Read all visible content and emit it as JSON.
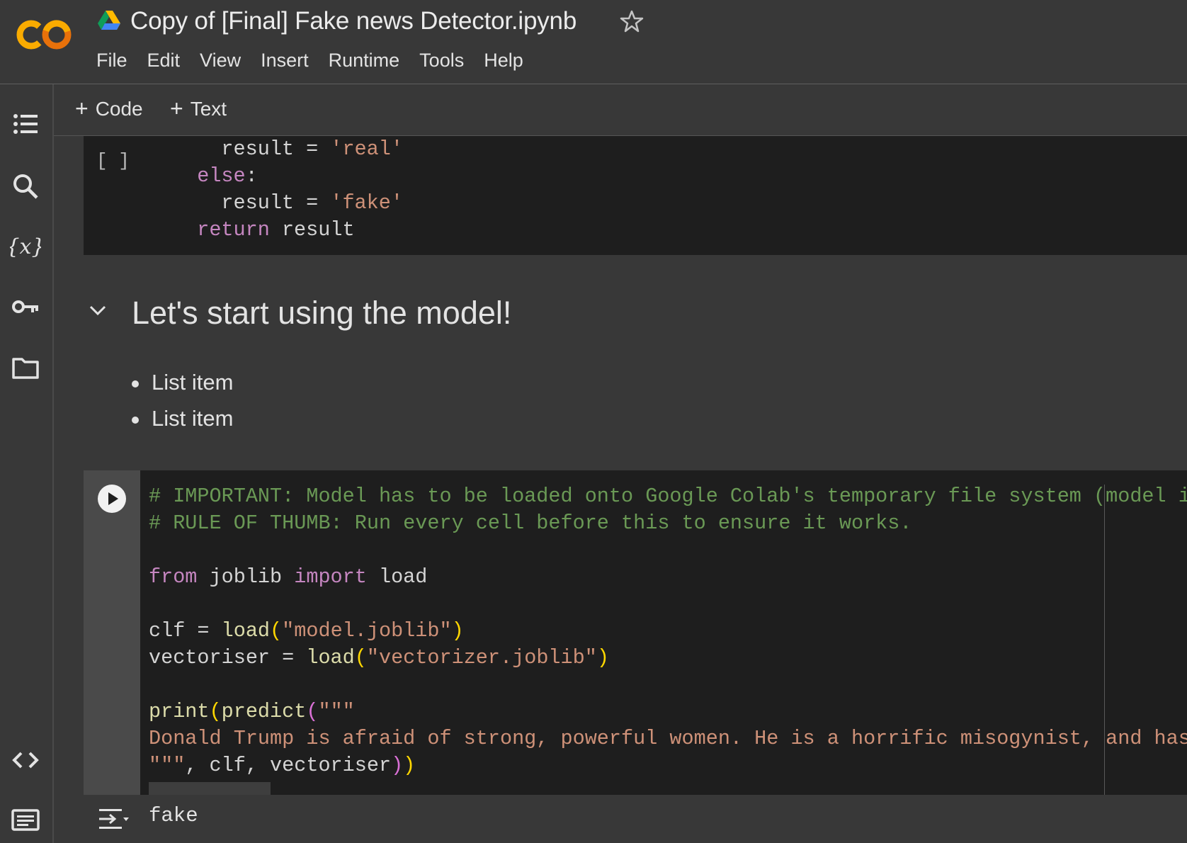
{
  "header": {
    "title": "Copy of [Final] Fake news Detector.ipynb",
    "logo_text": "CO",
    "menu": [
      "File",
      "Edit",
      "View",
      "Insert",
      "Runtime",
      "Tools",
      "Help"
    ]
  },
  "toolbar": {
    "code_label": "Code",
    "text_label": "Text"
  },
  "sidebar": {
    "icons": [
      "toc-icon",
      "search-icon",
      "variables-icon",
      "secrets-key-icon",
      "folder-icon",
      "code-snippets-icon",
      "terminal-icon"
    ]
  },
  "cells": {
    "cell1": {
      "exec_count": "[ ]",
      "lines": [
        [
          [
            "    result = ",
            ""
          ],
          [
            "'real'",
            "str"
          ]
        ],
        [
          [
            "  ",
            ""
          ],
          [
            "else",
            "kw"
          ],
          [
            ":",
            ""
          ]
        ],
        [
          [
            "    result = ",
            ""
          ],
          [
            "'fake'",
            "str"
          ]
        ],
        [
          [
            "  ",
            ""
          ],
          [
            "return",
            "kw"
          ],
          [
            " result",
            ""
          ]
        ]
      ]
    },
    "text_cell": {
      "heading": "Let's start using the model!",
      "bullets": [
        "List item",
        "List item"
      ]
    },
    "cell2": {
      "lines": [
        [
          [
            "# IMPORTANT: Model has to be loaded onto Google Colab's temporary file system (model is",
            "cmt"
          ]
        ],
        [
          [
            "# RULE OF THUMB: Run every cell before this to ensure it works.",
            "cmt"
          ]
        ],
        [
          [
            "",
            ""
          ]
        ],
        [
          [
            "from",
            "kw"
          ],
          [
            " joblib ",
            ""
          ],
          [
            "import",
            "kw"
          ],
          [
            " load",
            ""
          ]
        ],
        [
          [
            "",
            ""
          ]
        ],
        [
          [
            "clf = ",
            ""
          ],
          [
            "load",
            "fn"
          ],
          [
            "(",
            "brk"
          ],
          [
            "\"model.joblib\"",
            "str"
          ],
          [
            ")",
            "brk"
          ]
        ],
        [
          [
            "vectoriser = ",
            ""
          ],
          [
            "load",
            "fn"
          ],
          [
            "(",
            "brk"
          ],
          [
            "\"vectorizer.joblib\"",
            "str"
          ],
          [
            ")",
            "brk"
          ]
        ],
        [
          [
            "",
            ""
          ]
        ],
        [
          [
            "print",
            "fn"
          ],
          [
            "(",
            "brk"
          ],
          [
            "predict",
            "fn"
          ],
          [
            "(",
            "brk2"
          ],
          [
            "\"\"\"",
            "str"
          ]
        ],
        [
          [
            "Donald Trump is afraid of strong, powerful women. He is a horrific misogynist, and has",
            "str"
          ]
        ],
        [
          [
            "\"\"\"",
            "str"
          ],
          [
            ", clf, vectoriser",
            ""
          ],
          [
            ")",
            "brk2"
          ],
          [
            ")",
            "brk"
          ]
        ]
      ],
      "output": "fake"
    }
  },
  "colors": {
    "background": "#383838",
    "code_background": "#1e1e1e",
    "keyword": "#c586c0",
    "string": "#ce9178",
    "comment": "#6a9955",
    "function": "#dcdcaa"
  }
}
